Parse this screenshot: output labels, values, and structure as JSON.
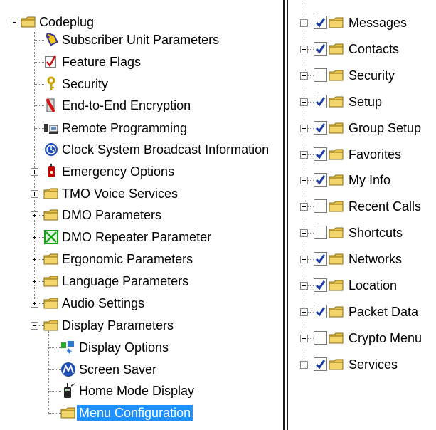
{
  "left_tree": {
    "root": {
      "label": "Codeplug",
      "icon": "folder-icon",
      "expanded": true
    },
    "items": [
      {
        "label": "Subscriber Unit Parameters",
        "icon": "tag-icon",
        "expandable": false
      },
      {
        "label": "Feature Flags",
        "icon": "flag-check-icon",
        "expandable": false
      },
      {
        "label": "Security",
        "icon": "key-icon",
        "expandable": false
      },
      {
        "label": "End-to-End Encryption",
        "icon": "encryption-icon",
        "expandable": false
      },
      {
        "label": "Remote Programming",
        "icon": "remote-programming-icon",
        "expandable": false
      },
      {
        "label": "Clock System Broadcast Information",
        "icon": "globe-clock-icon",
        "expandable": false
      },
      {
        "label": "Emergency Options",
        "icon": "emergency-radio-icon",
        "expandable": true,
        "expanded": false
      },
      {
        "label": "TMO Voice Services",
        "icon": "folder-icon",
        "expandable": true,
        "expanded": false
      },
      {
        "label": "DMO Parameters",
        "icon": "folder-icon",
        "expandable": true,
        "expanded": false
      },
      {
        "label": "DMO Repeater Parameter",
        "icon": "repeater-icon",
        "expandable": true,
        "expanded": false
      },
      {
        "label": "Ergonomic Parameters",
        "icon": "folder-icon",
        "expandable": true,
        "expanded": false
      },
      {
        "label": "Language Parameters",
        "icon": "folder-icon",
        "expandable": true,
        "expanded": false
      },
      {
        "label": "Audio Settings",
        "icon": "folder-icon",
        "expandable": true,
        "expanded": false
      },
      {
        "label": "Display Parameters",
        "icon": "folder-icon",
        "expandable": true,
        "expanded": true,
        "children": [
          {
            "label": "Display Options",
            "icon": "display-options-icon"
          },
          {
            "label": "Screen Saver",
            "icon": "motorola-logo-icon"
          },
          {
            "label": "Home Mode Display",
            "icon": "handheld-radio-icon"
          },
          {
            "label": "Menu Configuration",
            "icon": "folder-icon",
            "selected": true
          }
        ]
      }
    ]
  },
  "right_tree": {
    "items": [
      {
        "label": "Messages",
        "checked": true
      },
      {
        "label": "Contacts",
        "checked": true
      },
      {
        "label": "Security",
        "checked": false
      },
      {
        "label": "Setup",
        "checked": true
      },
      {
        "label": "Group Setup",
        "checked": true
      },
      {
        "label": "Favorites",
        "checked": true
      },
      {
        "label": "My Info",
        "checked": true
      },
      {
        "label": "Recent Calls",
        "checked": false
      },
      {
        "label": "Shortcuts",
        "checked": false
      },
      {
        "label": "Networks",
        "checked": true
      },
      {
        "label": "Location",
        "checked": true
      },
      {
        "label": "Packet Data",
        "checked": true
      },
      {
        "label": "Crypto Menu",
        "checked": false
      },
      {
        "label": "Services",
        "checked": true
      }
    ]
  },
  "colors": {
    "selection": "#1e90ff",
    "folder": "#e8c24a",
    "check": "#1b3fa8"
  }
}
